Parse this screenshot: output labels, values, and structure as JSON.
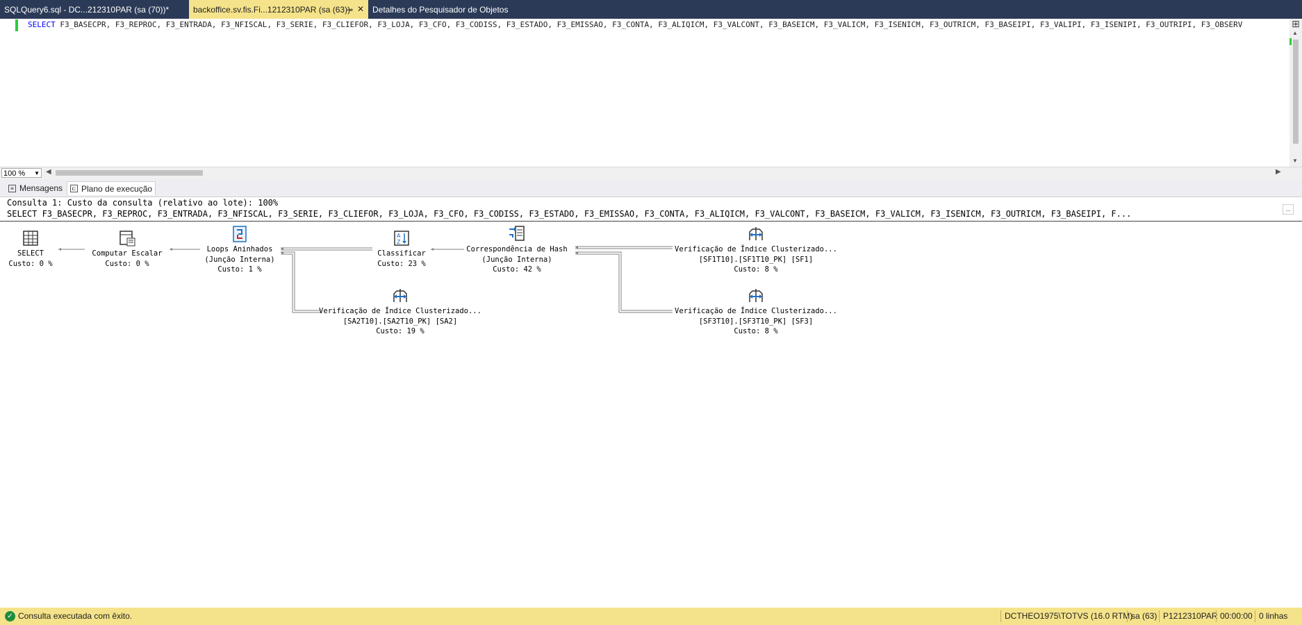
{
  "tabs": [
    {
      "label": "SQLQuery6.sql - DC...212310PAR (sa (70))*",
      "active": false
    },
    {
      "label": "backoffice.sv.fis.Fi...1212310PAR (sa (63))",
      "active": true
    },
    {
      "label": "Detalhes do Pesquisador de Objetos",
      "active": false
    }
  ],
  "editor": {
    "sql_keyword": "SELECT",
    "sql_rest": " F3_BASECPR, F3_REPROC, F3_ENTRADA, F3_NFISCAL, F3_SERIE, F3_CLIEFOR, F3_LOJA, F3_CFO, F3_CODISS, F3_ESTADO, F3_EMISSAO, F3_CONTA, F3_ALIQICM, F3_VALCONT, F3_BASEICM, F3_VALICM, F3_ISENICM, F3_OUTRICM, F3_BASEIPI, F3_VALIPI, F3_ISENIPI, F3_OUTRIPI, F3_OBSERV"
  },
  "zoom": {
    "value": "100 %"
  },
  "result_tabs": [
    {
      "label": "Mensagens",
      "icon": "messages-icon"
    },
    {
      "label": "Plano de execução",
      "icon": "plan-icon",
      "active": true
    }
  ],
  "plan": {
    "header": "Consulta 1: Custo da consulta (relativo ao lote): 100%",
    "query": "SELECT F3_BASECPR, F3_REPROC, F3_ENTRADA, F3_NFISCAL, F3_SERIE, F3_CLIEFOR, F3_LOJA, F3_CFO, F3_CODISS, F3_ESTADO, F3_EMISSAO, F3_CONTA, F3_ALIQICM, F3_VALCONT, F3_BASEICM, F3_VALICM, F3_ISENICM, F3_OUTRICM, F3_BASEIPI, F...",
    "more_button": "...",
    "nodes": {
      "select": {
        "name": "SELECT",
        "cost": "Custo: 0 %"
      },
      "compute": {
        "name": "Computar Escalar",
        "cost": "Custo: 0 %"
      },
      "loops": {
        "name": "Loops Aninhados",
        "sub": "(Junção Interna)",
        "cost": "Custo: 1 %"
      },
      "sort": {
        "name": "Classificar",
        "cost": "Custo: 23 %"
      },
      "hash": {
        "name": "Correspondência de Hash",
        "sub": "(Junção Interna)",
        "cost": "Custo: 42 %"
      },
      "scan_sf1": {
        "name": "Verificação de Índice Clusterizado...",
        "sub": "[SF1T10].[SF1T10_PK] [SF1]",
        "cost": "Custo: 8 %"
      },
      "scan_sa2": {
        "name": "Verificação de Índice Clusterizado...",
        "sub": "[SA2T10].[SA2T10_PK] [SA2]",
        "cost": "Custo: 19 %"
      },
      "scan_sf3": {
        "name": "Verificação de Índice Clusterizado...",
        "sub": "[SF3T10].[SF3T10_PK] [SF3]",
        "cost": "Custo: 8 %"
      }
    }
  },
  "status": {
    "message": "Consulta executada com êxito.",
    "server": "DCTHEO1975\\TOTVS (16.0 RTM)",
    "user": "sa (63)",
    "database": "P1212310PAR",
    "time": "00:00:00",
    "rows": "0 linhas"
  },
  "colors": {
    "tabbar": "#2b3a57",
    "active_tab": "#f5e38b",
    "status_bar": "#f5e38b",
    "keyword": "#0000ff",
    "gutter": "#2ecc40"
  }
}
